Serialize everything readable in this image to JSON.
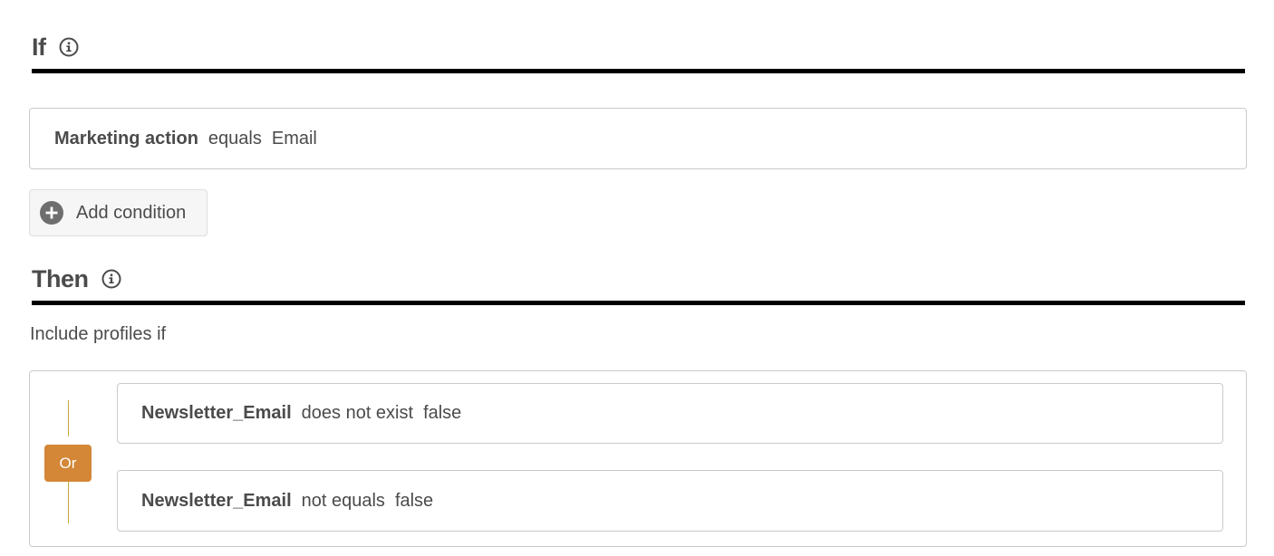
{
  "if_section": {
    "title": "If",
    "info_icon": "info-icon",
    "condition": {
      "field": "Marketing action",
      "operator": "equals",
      "value": "Email"
    },
    "add_condition_label": "Add condition",
    "add_icon": "plus-circle-icon"
  },
  "then_section": {
    "title": "Then",
    "info_icon": "info-icon",
    "include_label": "Include profiles if",
    "group": {
      "logic_label": "Or",
      "logic_color": "#d38737",
      "conditions": [
        {
          "field": "Newsletter_Email",
          "operator": "does not exist",
          "value": "false"
        },
        {
          "field": "Newsletter_Email",
          "operator": "not equals",
          "value": "false"
        }
      ]
    }
  }
}
